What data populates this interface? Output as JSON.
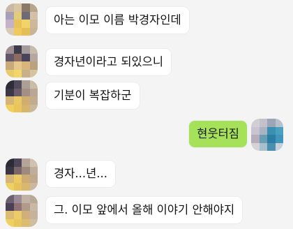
{
  "messages": [
    {
      "id": "m1",
      "sender": "other",
      "text": "아는 이모 이름 박경자인데"
    },
    {
      "id": "m2",
      "sender": "other",
      "text": "경자년이라고 되있으니"
    },
    {
      "id": "m3",
      "sender": "other",
      "text": "기분이 복잡하군"
    },
    {
      "id": "m4",
      "sender": "me",
      "text": "현웃터짐"
    },
    {
      "id": "m5",
      "sender": "other",
      "text": "경자...년..."
    },
    {
      "id": "m6",
      "sender": "other",
      "text": "그. 이모 앞에서 올해 이야기 안해야지"
    }
  ],
  "colors": {
    "background": "#f4f4f4",
    "bubble_other": "#ffffff",
    "bubble_mine": "#a6e15a"
  }
}
